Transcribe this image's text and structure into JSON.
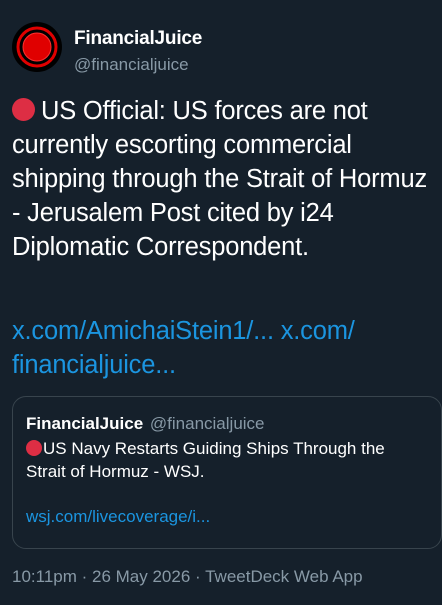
{
  "author": {
    "display_name": "FinancialJuice",
    "handle": "@financialjuice",
    "avatar_icon": "red-target-logo-icon"
  },
  "tweet": {
    "text_line1": "US Official: US forces are not",
    "text_rest": "currently escorting commercial shipping through the Strait of Hormuz - Jerusalem Post cited by i24 Diplomatic Correspondent.",
    "link1": "x.com/AmichaiStein1/...",
    "link2": "x.com/ financialjuice...",
    "dot_icon": "red-circle-icon"
  },
  "quote": {
    "display_name": "FinancialJuice",
    "handle": "@financialjuice",
    "text_line1": "US Navy Restarts Guiding Ships Through the",
    "text_line2": "Strait of Hormuz - WSJ.",
    "link": "wsj.com/livecoverage/i..."
  },
  "footer": {
    "meta": "10:11pm · 26 May 2026 · TweetDeck Web App"
  },
  "colors": {
    "background": "#15202b",
    "text": "#ffffff",
    "muted": "#8899a6",
    "link": "#1b95e0",
    "red_dot": "#dd2e44",
    "border": "#38444d"
  }
}
